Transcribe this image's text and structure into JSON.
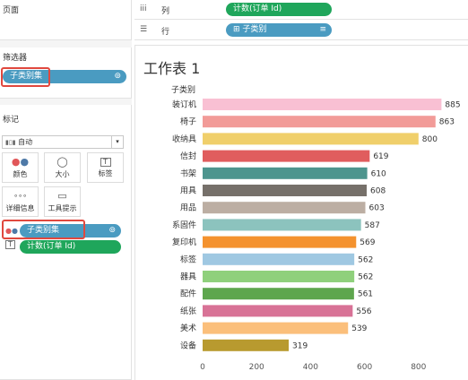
{
  "pages_panel": {
    "title": "页面"
  },
  "filters_panel": {
    "title": "筛选器",
    "pill": "子类别集"
  },
  "marks_panel": {
    "title": "标记",
    "mark_type": "自动",
    "buttons": [
      {
        "label": "颜色",
        "icon": "color-dots-icon"
      },
      {
        "label": "大小",
        "icon": "size-icon"
      },
      {
        "label": "标签",
        "icon": "label-icon"
      },
      {
        "label": "详细信息",
        "icon": "detail-icon"
      },
      {
        "label": "工具提示",
        "icon": "tooltip-icon"
      }
    ],
    "fields": [
      {
        "label": "子类别集",
        "role": "color"
      },
      {
        "label": "计数(订单 Id)",
        "role": "label"
      }
    ]
  },
  "shelves": {
    "columns": {
      "label": "列",
      "pill": "计数(订单 Id)"
    },
    "rows": {
      "label": "行",
      "pill": "子类别"
    }
  },
  "sheet": {
    "title": "工作表 1"
  },
  "colors": {
    "blue_pill": "#4a9bc1",
    "green_pill": "#1fa65b",
    "highlight": "#e0483e"
  },
  "chart_data": {
    "type": "bar",
    "orientation": "horizontal",
    "ylabel": "子类别",
    "categories": [
      "装订机",
      "椅子",
      "收纳具",
      "信封",
      "书架",
      "用具",
      "用品",
      "系固件",
      "复印机",
      "标签",
      "器具",
      "配件",
      "纸张",
      "美术",
      "设备"
    ],
    "values": [
      885,
      863,
      800,
      619,
      610,
      608,
      603,
      587,
      569,
      562,
      562,
      561,
      556,
      539,
      319
    ],
    "colors": [
      "#f9c0d3",
      "#f29b98",
      "#f0cf6b",
      "#e05d5e",
      "#4d958e",
      "#76706a",
      "#bcaea3",
      "#8cc3be",
      "#f4922e",
      "#9fc8e2",
      "#8fd07c",
      "#5ea64e",
      "#d87296",
      "#fbbf7b",
      "#b89a2f"
    ],
    "xlim": [
      0,
      1000
    ],
    "xticks": [
      0,
      200,
      400,
      600,
      800,
      "1"
    ],
    "grid": false
  }
}
